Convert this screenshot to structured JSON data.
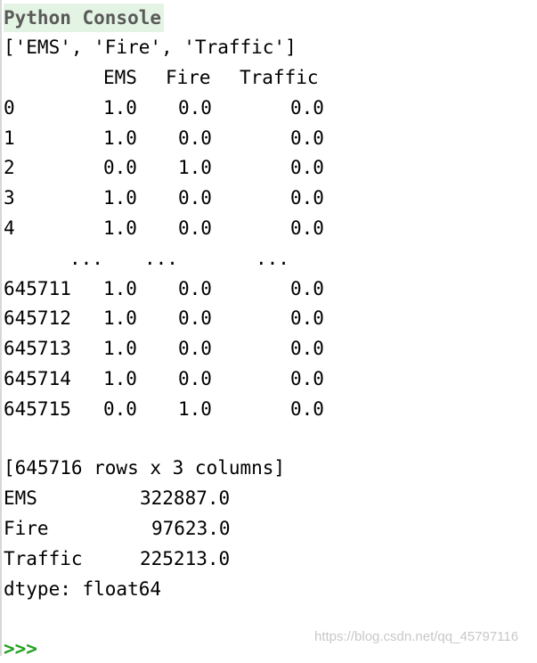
{
  "console": {
    "title": "Python Console",
    "list_output": "['EMS', 'Fire', 'Traffic']",
    "dataframe": {
      "columns": [
        "EMS",
        "Fire",
        "Traffic"
      ],
      "rows": [
        {
          "index": "0",
          "EMS": "1.0",
          "Fire": "0.0",
          "Traffic": "0.0"
        },
        {
          "index": "1",
          "EMS": "1.0",
          "Fire": "0.0",
          "Traffic": "0.0"
        },
        {
          "index": "2",
          "EMS": "0.0",
          "Fire": "1.0",
          "Traffic": "0.0"
        },
        {
          "index": "3",
          "EMS": "1.0",
          "Fire": "0.0",
          "Traffic": "0.0"
        },
        {
          "index": "4",
          "EMS": "1.0",
          "Fire": "0.0",
          "Traffic": "0.0"
        },
        {
          "index": "",
          "EMS": "...",
          "Fire": "...",
          "Traffic": "..."
        },
        {
          "index": "645711",
          "EMS": "1.0",
          "Fire": "0.0",
          "Traffic": "0.0"
        },
        {
          "index": "645712",
          "EMS": "1.0",
          "Fire": "0.0",
          "Traffic": "0.0"
        },
        {
          "index": "645713",
          "EMS": "1.0",
          "Fire": "0.0",
          "Traffic": "0.0"
        },
        {
          "index": "645714",
          "EMS": "1.0",
          "Fire": "0.0",
          "Traffic": "0.0"
        },
        {
          "index": "645715",
          "EMS": "0.0",
          "Fire": "1.0",
          "Traffic": "0.0"
        }
      ],
      "shape_text": "[645716 rows x 3 columns]"
    },
    "series": [
      {
        "label": "EMS",
        "value": "322887.0"
      },
      {
        "label": "Fire",
        "value": "97623.0"
      },
      {
        "label": "Traffic",
        "value": "225213.0"
      }
    ],
    "dtype_text": "dtype: float64",
    "prompt": ">>>"
  },
  "watermark": "https://blog.csdn.net/qq_45797116",
  "colors": {
    "title_bg": "#e4f4e4",
    "prompt": "#22a022"
  }
}
